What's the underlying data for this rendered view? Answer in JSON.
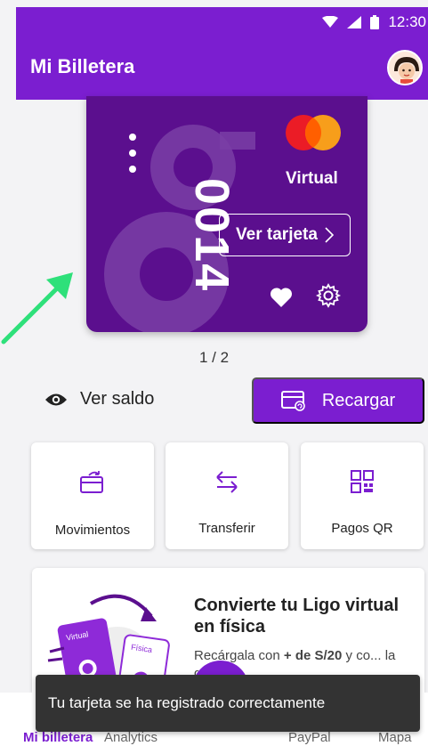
{
  "status_bar": {
    "time": "12:30",
    "icons": [
      "wifi-icon",
      "signal-icon",
      "battery-icon"
    ]
  },
  "app_bar": {
    "title": "Mi Billetera",
    "avatar_icon": "avatar-icon"
  },
  "card": {
    "digits": "0014",
    "network_logo": "mastercard-logo",
    "type_label": "Virtual",
    "view_button": "Ver tarjeta",
    "favorite_icon": "heart-icon",
    "settings_icon": "gear-icon"
  },
  "pager": "1 / 2",
  "balance": {
    "label": "Ver saldo",
    "icon": "eye-icon"
  },
  "recharge": {
    "label": "Recargar",
    "icon": "card-recharge-icon"
  },
  "actions": [
    {
      "label": "Movimientos",
      "icon": "wallet-movements-icon"
    },
    {
      "label": "Transferir",
      "icon": "transfer-arrows-icon"
    },
    {
      "label": "Pagos QR",
      "icon": "qr-icon"
    }
  ],
  "promo": {
    "title": "Convierte tu Ligo virtual en física",
    "text_before": "Recárgala con ",
    "text_bold": "+ de S/20",
    "text_after": " y co... la grátis",
    "art_card_virtual": "Virtual",
    "art_card_fisica": "Física"
  },
  "snackbar": "Tu tarjeta se ha registrado correctamente",
  "bottom_nav": [
    {
      "label": "Mi billetera",
      "active": true
    },
    {
      "label": "Analytics",
      "active": false
    },
    {
      "label": "PayPal",
      "active": false
    },
    {
      "label": "Mapa",
      "active": false
    }
  ],
  "colors": {
    "primary": "#7b1ed0",
    "card": "#5b0f8e",
    "arrow": "#2ee07a",
    "snackbar": "#333333"
  }
}
